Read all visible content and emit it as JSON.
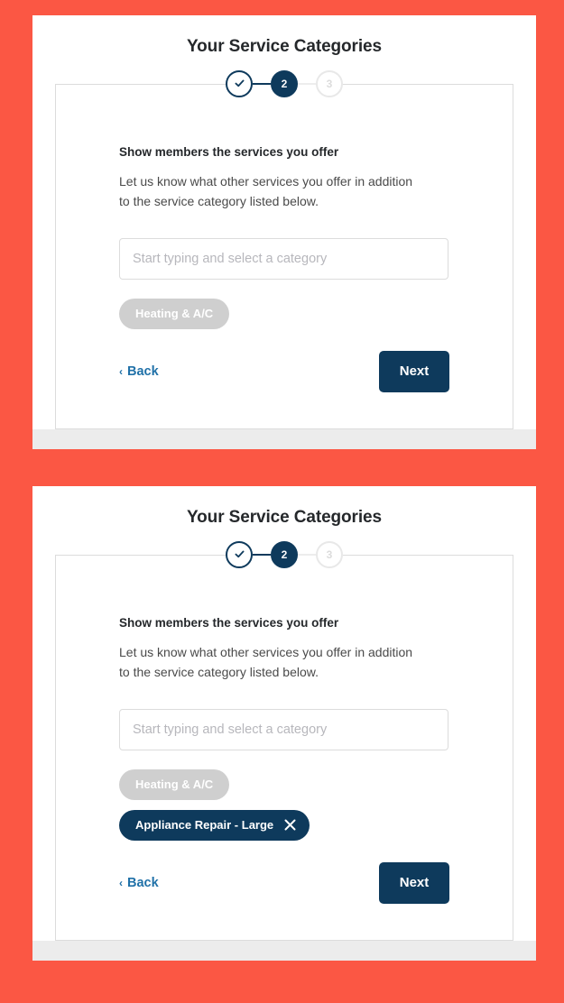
{
  "theme": {
    "page_background": "#FB5744",
    "card_background": "#FFFFFF",
    "brand_navy": "#0E3A5C",
    "link_blue": "#2071A8",
    "chip_locked_grey": "#CFCFCF",
    "footer_grey": "#ECECEC"
  },
  "panels": [
    {
      "title": "Your Service Categories",
      "stepper": {
        "steps": [
          {
            "label": "",
            "state": "completed",
            "icon": "check-icon"
          },
          {
            "label": "2",
            "state": "current",
            "icon": ""
          },
          {
            "label": "3",
            "state": "upcoming",
            "icon": ""
          }
        ]
      },
      "heading": "Show members the services you offer",
      "description": "Let us know what other services you offer in addition to the service category listed below.",
      "input": {
        "placeholder": "Start typing and select a category",
        "value": ""
      },
      "chips": [
        {
          "label": "Heating & A/C",
          "removable": false,
          "remove_icon": ""
        }
      ],
      "back_label": "Back",
      "back_chevron": "‹",
      "next_label": "Next"
    },
    {
      "title": "Your Service Categories",
      "stepper": {
        "steps": [
          {
            "label": "",
            "state": "completed",
            "icon": "check-icon"
          },
          {
            "label": "2",
            "state": "current",
            "icon": ""
          },
          {
            "label": "3",
            "state": "upcoming",
            "icon": ""
          }
        ]
      },
      "heading": "Show members the services you offer",
      "description": "Let us know what other services you offer in addition to the service category listed below.",
      "input": {
        "placeholder": "Start typing and select a category",
        "value": ""
      },
      "chips": [
        {
          "label": "Heating & A/C",
          "removable": false,
          "remove_icon": ""
        },
        {
          "label": "Appliance Repair - Large",
          "removable": true,
          "remove_icon": "close-icon"
        }
      ],
      "back_label": "Back",
      "back_chevron": "‹",
      "next_label": "Next"
    }
  ]
}
